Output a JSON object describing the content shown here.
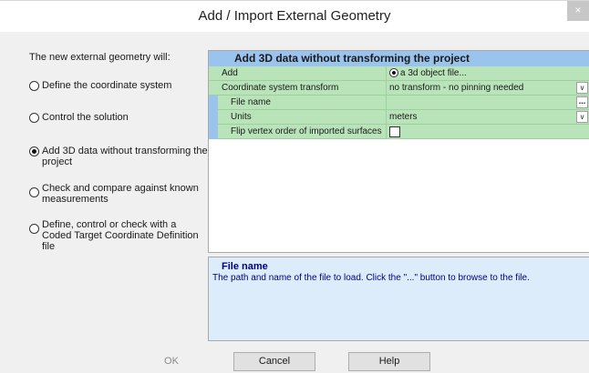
{
  "window": {
    "title": "Add / Import External Geometry",
    "close_label": "×"
  },
  "left_panel": {
    "heading": "The new external geometry will:",
    "options": [
      {
        "label": "Define the coordinate system",
        "selected": false
      },
      {
        "label": "Control the solution",
        "selected": false
      },
      {
        "label": "Add 3D data without transforming the project",
        "selected": true
      },
      {
        "label": "Check and compare against known measurements",
        "selected": false
      },
      {
        "label": "Define, control or check with a Coded Target Coordinate Definition file",
        "selected": false
      }
    ]
  },
  "property_grid": {
    "header": "Add 3D data without transforming the project",
    "rows": [
      {
        "name": "Add",
        "value": "a 3d object file...",
        "control": "radio"
      },
      {
        "name": "Coordinate system transform",
        "value": "no transform - no pinning needed",
        "control": "dropdown"
      },
      {
        "name": "File name",
        "value": "",
        "control": "browse"
      },
      {
        "name": "Units",
        "value": "meters",
        "control": "dropdown"
      },
      {
        "name": "Flip vertex order of imported surfaces",
        "value": "",
        "control": "checkbox",
        "checked": false
      }
    ],
    "browse_label": "...",
    "dropdown_glyph": "∨"
  },
  "help": {
    "title": "File name",
    "description": "The path and name of the file to load. Click the \"...\" button to browse to the file."
  },
  "buttons": {
    "ok": "OK",
    "cancel": "Cancel",
    "help": "Help"
  },
  "colors": {
    "grid_header": "#9ac4ee",
    "grid_row": "#b9e4b9",
    "help_bg": "#ddecfb",
    "help_text": "#000080"
  }
}
